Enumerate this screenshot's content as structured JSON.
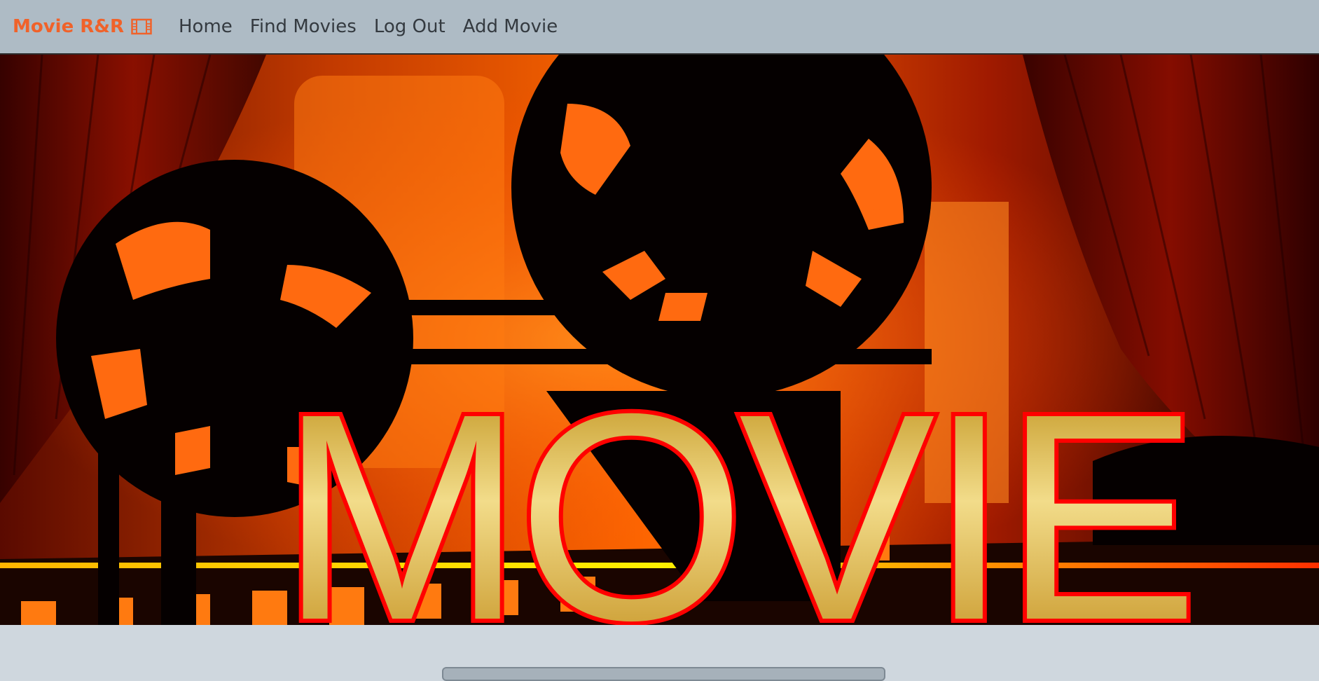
{
  "navbar": {
    "brand": "Movie R&R",
    "brand_icon": "film-icon",
    "links": [
      "Home",
      "Find Movies",
      "Log Out",
      "Add Movie"
    ]
  },
  "hero": {
    "title": "MOVIE",
    "graphic": "film-projector-reels",
    "colors": {
      "brand": "#f0622a",
      "navbar_bg": "#aebbc5",
      "page_bg": "#cfd7de",
      "hero_orange": "#ff6a00",
      "title_gold": "#d4a52a",
      "title_outline": "#ff0000"
    }
  }
}
